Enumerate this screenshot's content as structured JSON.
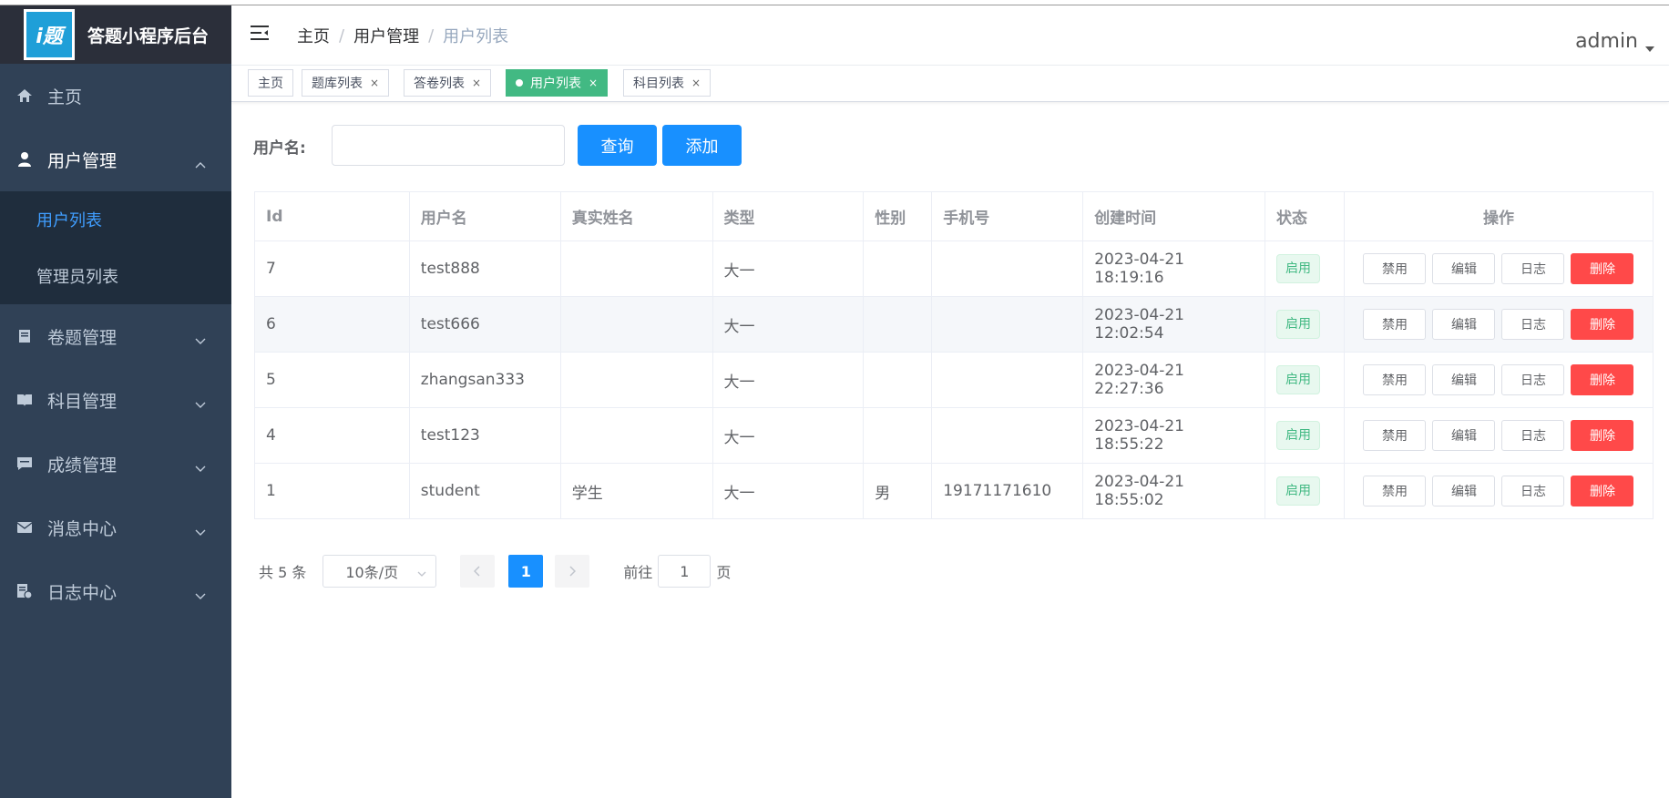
{
  "brand": {
    "logo_text": "i题",
    "title": "答题小程序后台"
  },
  "sidebar": {
    "items": [
      {
        "label": "主页",
        "icon": "home-icon"
      },
      {
        "label": "用户管理",
        "icon": "user-icon",
        "expanded": true,
        "children": [
          {
            "label": "用户列表",
            "active": true
          },
          {
            "label": "管理员列表"
          }
        ]
      },
      {
        "label": "卷题管理",
        "icon": "paper-icon"
      },
      {
        "label": "科目管理",
        "icon": "book-icon"
      },
      {
        "label": "成绩管理",
        "icon": "chat-icon"
      },
      {
        "label": "消息中心",
        "icon": "mail-icon"
      },
      {
        "label": "日志中心",
        "icon": "log-icon"
      }
    ]
  },
  "header": {
    "breadcrumb": [
      "主页",
      "用户管理",
      "用户列表"
    ],
    "user": "admin"
  },
  "tags": [
    {
      "label": "主页",
      "closable": false
    },
    {
      "label": "题库列表",
      "closable": true
    },
    {
      "label": "答卷列表",
      "closable": true
    },
    {
      "label": "用户列表",
      "closable": true,
      "active": true
    },
    {
      "label": "科目列表",
      "closable": true
    }
  ],
  "search": {
    "label": "用户名:",
    "value": "",
    "query_button": "查询",
    "add_button": "添加"
  },
  "table": {
    "columns": [
      "Id",
      "用户名",
      "真实姓名",
      "类型",
      "性别",
      "手机号",
      "创建时间",
      "状态",
      "操作"
    ],
    "rows": [
      {
        "id": "7",
        "username": "test888",
        "realname": "",
        "type": "大一",
        "gender": "",
        "phone": "",
        "created": "2023-04-21 18:19:16",
        "status": "启用"
      },
      {
        "id": "6",
        "username": "test666",
        "realname": "",
        "type": "大一",
        "gender": "",
        "phone": "",
        "created": "2023-04-21 12:02:54",
        "status": "启用"
      },
      {
        "id": "5",
        "username": "zhangsan333",
        "realname": "",
        "type": "大一",
        "gender": "",
        "phone": "",
        "created": "2023-04-21 22:27:36",
        "status": "启用"
      },
      {
        "id": "4",
        "username": "test123",
        "realname": "",
        "type": "大一",
        "gender": "",
        "phone": "",
        "created": "2023-04-21 18:55:22",
        "status": "启用"
      },
      {
        "id": "1",
        "username": "student",
        "realname": "学生",
        "type": "大一",
        "gender": "男",
        "phone": "19171171610",
        "created": "2023-04-21 18:55:02",
        "status": "启用"
      }
    ],
    "actions": {
      "disable": "禁用",
      "edit": "编辑",
      "log": "日志",
      "delete": "删除"
    }
  },
  "pagination": {
    "total_text": "共 5 条",
    "page_size": "10条/页",
    "current_page": "1",
    "goto_label": "前往",
    "goto_value": "1",
    "page_suffix": "页"
  },
  "colors": {
    "sidebar_bg": "#304156",
    "primary": "#1890ff",
    "active_tag": "#42b983",
    "danger": "#ff4949"
  }
}
